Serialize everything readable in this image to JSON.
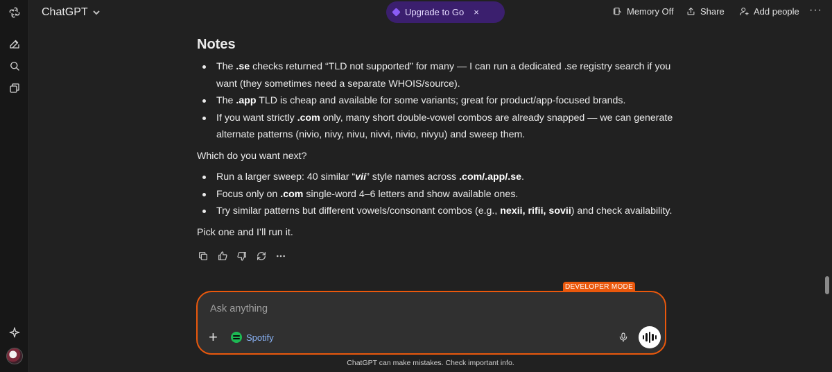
{
  "header": {
    "app_title": "ChatGPT",
    "upgrade_label": "Upgrade to Go",
    "upgrade_close": "×",
    "memory_label": "Memory Off",
    "share_label": "Share",
    "add_people_label": "Add people",
    "more_label": "···"
  },
  "message": {
    "heading": "Notes",
    "notes": [
      {
        "pre": "The ",
        "b1": ".se",
        "post": " checks returned “TLD not supported” for many — I can run a dedicated .se registry search if you want (they sometimes need a separate WHOIS/source)."
      },
      {
        "pre": "The ",
        "b1": ".app",
        "post": " TLD is cheap and available for some variants; great for product/app-focused brands."
      },
      {
        "pre": "If you want strictly ",
        "b1": ".com",
        "post": " only, many short double-vowel combos are already snapped — we can generate alternate patterns (nivio, nivy, nivu, nivvi, nivio, nivyu) and sweep them."
      }
    ],
    "question": "Which do you want next?",
    "options": {
      "o1_pre": "Run a larger sweep: 40 similar “",
      "o1_it": "vii",
      "o1_mid": "” style names across ",
      "o1_b": ".com/.app/.se",
      "o1_post": ".",
      "o2_pre": "Focus only on ",
      "o2_b": ".com",
      "o2_post": " single-word 4–6 letters and show available ones.",
      "o3_pre": "Try similar patterns but different vowels/consonant combos (e.g., ",
      "o3_b": "nexii, rifii, sovii",
      "o3_post": ") and check availability."
    },
    "closing": "Pick one and I’ll run it."
  },
  "composer": {
    "badge": "DEVELOPER MODE",
    "placeholder": "Ask anything",
    "plus": "+",
    "spotify_label": "Spotify"
  },
  "footer": {
    "disclaimer": "ChatGPT can make mistakes. Check important info."
  },
  "colors": {
    "accent": "#ea580c",
    "upgrade_bg": "#3b1f6e",
    "spotify": "#1db954"
  }
}
